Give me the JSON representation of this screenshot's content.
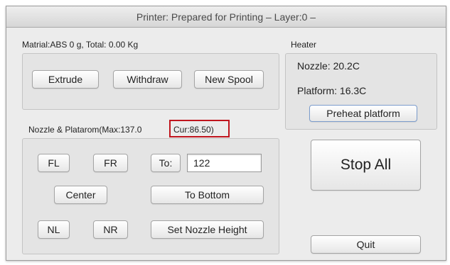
{
  "window": {
    "title": "Printer: Prepared for Printing – Layer:0 –"
  },
  "material": {
    "label": "Matrial:ABS 0 g,  Total: 0.00 Kg",
    "buttons": {
      "extrude": "Extrude",
      "withdraw": "Withdraw",
      "new_spool": "New Spool"
    }
  },
  "heater": {
    "label": "Heater",
    "nozzle": "Nozzle: 20.2C",
    "platform": "Platform: 16.3C",
    "preheat_button": "Preheat platform"
  },
  "nozzle_platform": {
    "label": "Nozzle & Platarom(Max:137.0",
    "current": "Cur:86.50)",
    "buttons": {
      "fl": "FL",
      "fr": "FR",
      "to": "To:",
      "center": "Center",
      "to_bottom": "To Bottom",
      "nl": "NL",
      "nr": "NR",
      "set_nozzle_height": "Set Nozzle  Height"
    },
    "to_value": "122"
  },
  "actions": {
    "stop_all": "Stop All",
    "quit": "Quit"
  },
  "colors": {
    "highlight": "#c0151e"
  }
}
